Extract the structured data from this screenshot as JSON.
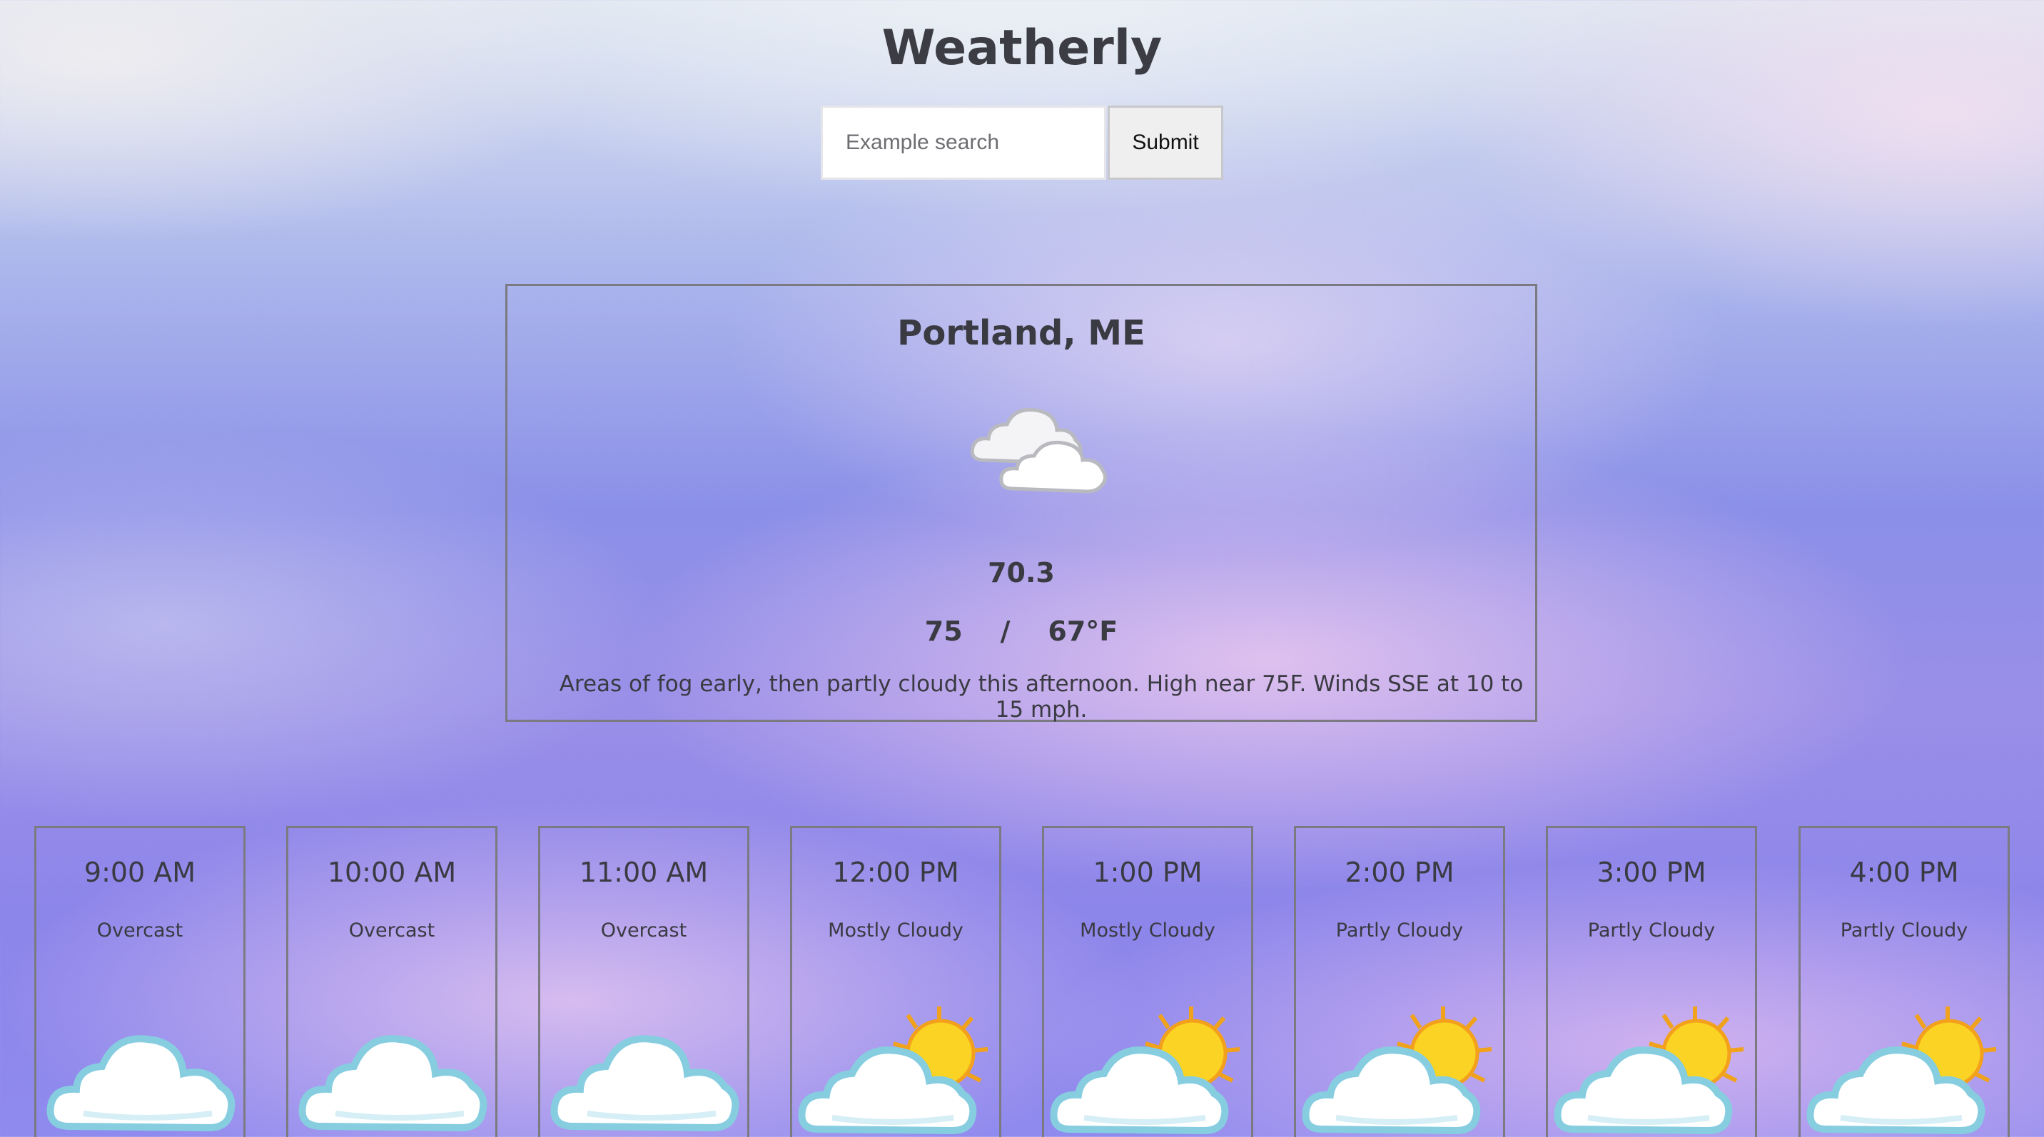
{
  "app": {
    "title": "Weatherly"
  },
  "search": {
    "placeholder": "Example search",
    "value": "",
    "submit_label": "Submit"
  },
  "current": {
    "location": "Portland, ME",
    "icon": "partly-cloudy-icon",
    "temperature": "70.3",
    "high": "75",
    "low": "67°F",
    "hi_lo_text": "75    /    67°F",
    "forecast": "Areas of fog early, then partly cloudy this afternoon. High near 75F. Winds SSE at 10 to 15 mph."
  },
  "hourly": [
    {
      "time": "9:00 AM",
      "condition": "Overcast",
      "icon": "cloud-icon"
    },
    {
      "time": "10:00 AM",
      "condition": "Overcast",
      "icon": "cloud-icon"
    },
    {
      "time": "11:00 AM",
      "condition": "Overcast",
      "icon": "cloud-icon"
    },
    {
      "time": "12:00 PM",
      "condition": "Mostly Cloudy",
      "icon": "sun-cloud-icon"
    },
    {
      "time": "1:00 PM",
      "condition": "Mostly Cloudy",
      "icon": "sun-cloud-icon"
    },
    {
      "time": "2:00 PM",
      "condition": "Partly Cloudy",
      "icon": "sun-cloud-icon"
    },
    {
      "time": "3:00 PM",
      "condition": "Partly Cloudy",
      "icon": "sun-cloud-icon"
    },
    {
      "time": "4:00 PM",
      "condition": "Partly Cloudy",
      "icon": "sun-cloud-icon"
    }
  ],
  "colors": {
    "text": "#3a3a42",
    "card_border": "#7a7a80",
    "sun": "#f5c518",
    "cloud_outline": "#8ecfe0"
  }
}
